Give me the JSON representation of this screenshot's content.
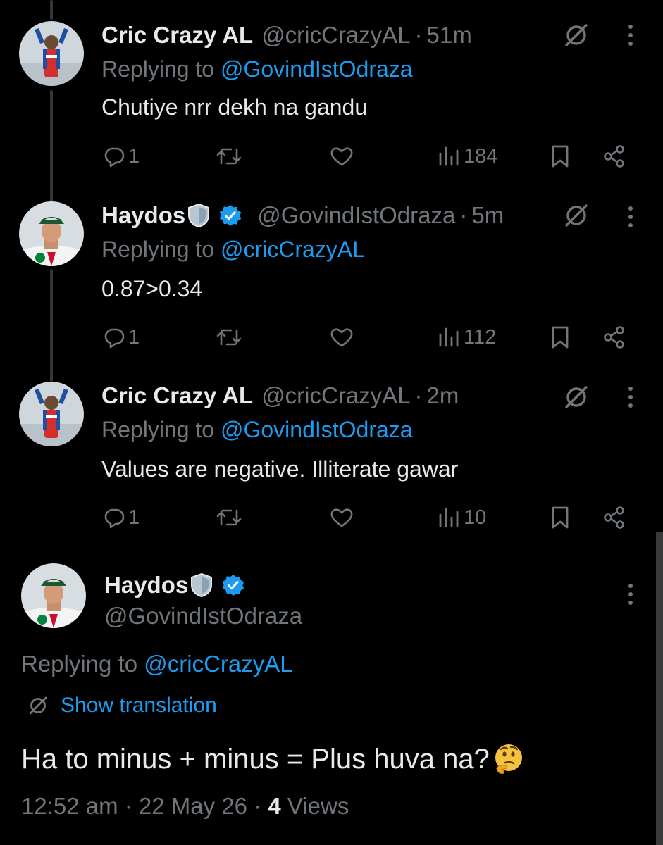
{
  "colors": {
    "background": "#000000",
    "text": "#e7e9ea",
    "muted": "#71767b",
    "link": "#1d9bf0",
    "verified": "#1d9bf0"
  },
  "replies": [
    {
      "name": "Cric Crazy AL",
      "verified": false,
      "handle": "@cricCrazyAL",
      "time": "51m",
      "replying_prefix": "Replying to ",
      "replying_to": "@GovindIstOdraza",
      "text": "Chutiye nrr dekh na gandu",
      "replies": "1",
      "views": "184"
    },
    {
      "name": "Haydos",
      "verified": true,
      "handle": "@GovindIstOdraza",
      "time": "5m",
      "replying_prefix": "Replying to ",
      "replying_to": "@cricCrazyAL",
      "text": "0.87>0.34",
      "replies": "1",
      "views": "112"
    },
    {
      "name": "Cric Crazy AL",
      "verified": false,
      "handle": "@cricCrazyAL",
      "time": "2m",
      "replying_prefix": "Replying to ",
      "replying_to": "@GovindIstOdraza",
      "text": "Values are negative. Illiterate gawar",
      "replies": "1",
      "views": "10"
    }
  ],
  "main": {
    "name": "Haydos",
    "verified": true,
    "handle": "@GovindIstOdraza",
    "replying_prefix": "Replying to ",
    "replying_to": "@cricCrazyAL",
    "translate_label": "Show translation",
    "text": "Ha to minus + minus = Plus huva na?",
    "emoji": "thinking-face",
    "timestamp": "12:52 am",
    "date": "22 May 26",
    "views_count": "4",
    "views_label": "Views"
  },
  "icons": [
    "grok-icon",
    "more-icon",
    "reply-icon",
    "retweet-icon",
    "like-icon",
    "views-icon",
    "bookmark-icon",
    "share-icon",
    "translate-icon",
    "shield-icon",
    "verified-badge-icon"
  ]
}
